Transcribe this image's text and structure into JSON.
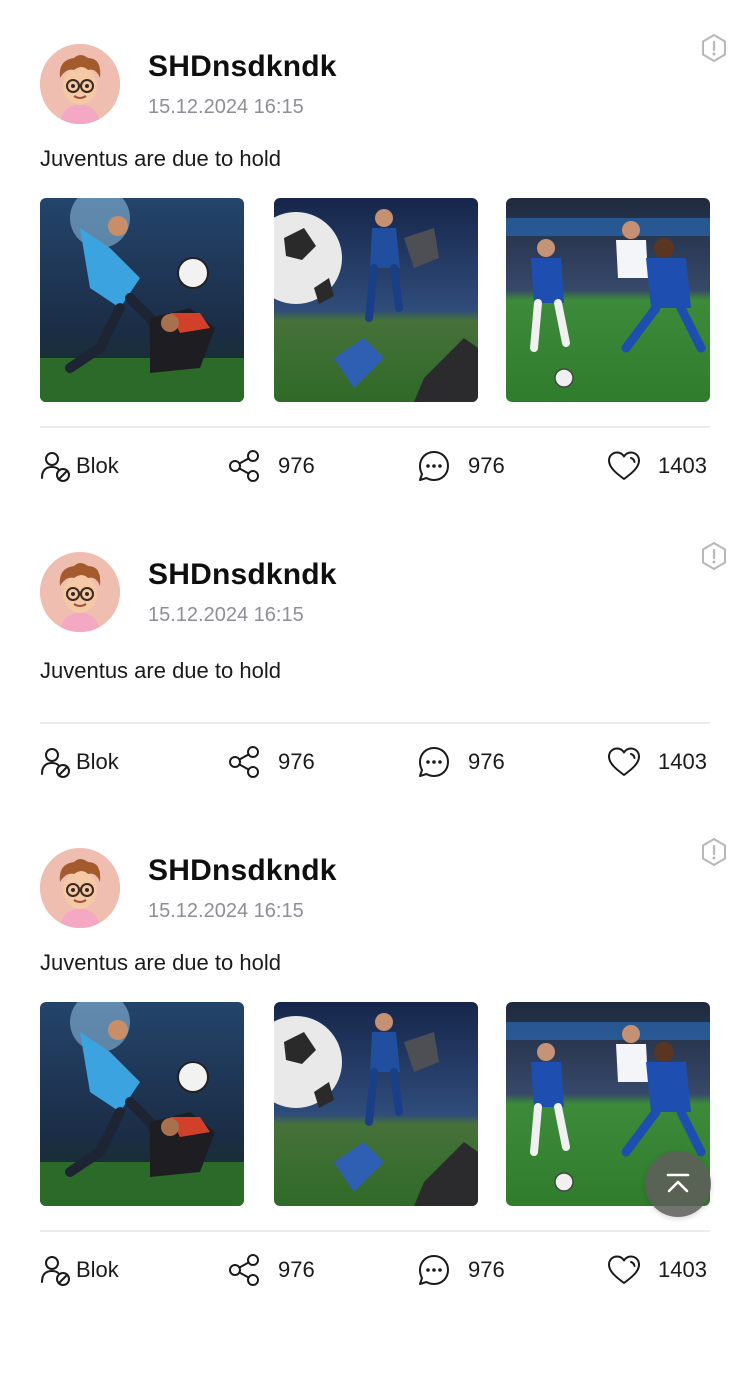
{
  "posts": [
    {
      "username": "SHDnsdkndk",
      "timestamp": "15.12.2024 16:15",
      "text": "Juventus are due to hold",
      "has_images": true,
      "actions": {
        "block_label": "Blok",
        "shares": "976",
        "comments": "976",
        "likes": "1403"
      }
    },
    {
      "username": "SHDnsdkndk",
      "timestamp": "15.12.2024 16:15",
      "text": "Juventus are due to hold",
      "has_images": false,
      "actions": {
        "block_label": "Blok",
        "shares": "976",
        "comments": "976",
        "likes": "1403"
      }
    },
    {
      "username": "SHDnsdkndk",
      "timestamp": "15.12.2024 16:15",
      "text": "Juventus are due to hold",
      "has_images": true,
      "actions": {
        "block_label": "Blok",
        "shares": "976",
        "comments": "976",
        "likes": "1403"
      }
    }
  ],
  "icons": {
    "report": "report-icon",
    "block": "block-user-icon",
    "share": "share-icon",
    "comment": "comment-icon",
    "like": "heart-icon",
    "scroll_top": "scroll-to-top-icon"
  },
  "colors": {
    "background": "#ffffff",
    "timestamp": "#8e8e96",
    "divider": "#ececec",
    "scroll_top_button": "#5f5f5a"
  }
}
